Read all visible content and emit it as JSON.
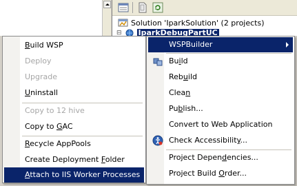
{
  "solution_explorer": {
    "solution_label": "Solution 'IparkSolution' (2 projects)",
    "project_label": "IparkDebugPartUC"
  },
  "left_menu": {
    "items": [
      {
        "label": "Build WSP",
        "accel": "B",
        "rest": "uild WSP",
        "enabled": true
      },
      {
        "label": "Deploy",
        "enabled": false
      },
      {
        "label": "Upgrade",
        "enabled": false
      },
      {
        "label": "Uninstall",
        "accel": "U",
        "rest": "ninstall",
        "enabled": true
      },
      {
        "label": "Copy to 12 hive",
        "enabled": false
      },
      {
        "label": "Copy to GAC",
        "pre": "Copy to ",
        "accel": "G",
        "rest": "AC",
        "enabled": true
      },
      {
        "label": "Recycle AppPools",
        "accel": "R",
        "rest": "ecycle AppPools",
        "enabled": true
      },
      {
        "label": "Create Deployment Folder",
        "pre": "Create Deployment ",
        "accel": "F",
        "rest": "older",
        "enabled": true
      },
      {
        "label": "Attach to IIS Worker Processes",
        "pre": "",
        "accel": "A",
        "rest": "ttach to IIS Worker Processes",
        "enabled": true,
        "selected": true
      }
    ]
  },
  "right_menu": {
    "items": [
      {
        "label": "WSPBuilder",
        "selected": true,
        "has_submenu": true
      },
      {
        "label": "Build",
        "pre": "Bu",
        "accel": "i",
        "rest": "ld",
        "icon": "build-icon"
      },
      {
        "label": "Rebuild",
        "pre": "Reb",
        "accel": "u",
        "rest": "ild"
      },
      {
        "label": "Clean",
        "pre": "Clea",
        "accel": "n",
        "rest": ""
      },
      {
        "label": "Publish...",
        "pre": "Pu",
        "accel": "b",
        "rest": "lish..."
      },
      {
        "label": "Convert to Web Application"
      },
      {
        "label": "Check Accessibility...",
        "pre": "Check Accessibilit",
        "accel": "y",
        "rest": "...",
        "icon": "accessibility-icon"
      },
      {
        "label": "Project Dependencies...",
        "pre": "Project Depen",
        "accel": "d",
        "rest": "encies..."
      },
      {
        "label": "Project Build Order...",
        "pre": "Project Build ",
        "accel": "O",
        "rest": "rder..."
      }
    ]
  }
}
